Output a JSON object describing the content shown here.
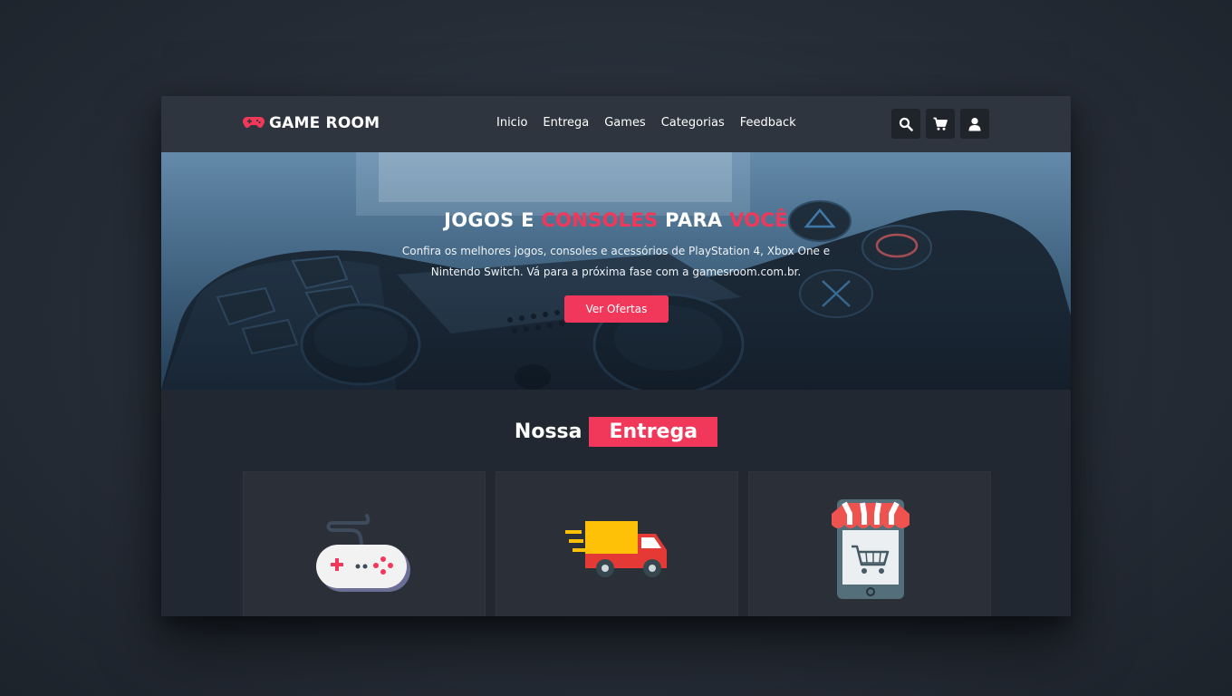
{
  "brand": {
    "name": "GAME ROOM",
    "icon": "gamepad-icon"
  },
  "nav": {
    "items": [
      "Inicio",
      "Entrega",
      "Games",
      "Categorias",
      "Feedback"
    ]
  },
  "header_icons": [
    "search-icon",
    "cart-icon",
    "user-icon"
  ],
  "hero": {
    "title_part1": "JOGOS E",
    "title_accent1": "CONSOLES",
    "title_part2": "PARA",
    "title_accent2": "VOCÊ",
    "text": "Confira os melhores jogos, consoles e acessórios de PlayStation 4, Xbox One e Nintendo Switch. Vá para a próxima fase com a gamesroom.com.br.",
    "button": "Ver Ofertas"
  },
  "section": {
    "title": "Nossa",
    "title_highlight": "Entrega"
  },
  "cards": [
    {
      "icon": "controller-icon"
    },
    {
      "icon": "delivery-truck-icon"
    },
    {
      "icon": "mobile-store-icon"
    }
  ],
  "colors": {
    "accent": "#f2385a",
    "background": "#222831",
    "nav": "#2e353f",
    "card": "#2b3038"
  }
}
